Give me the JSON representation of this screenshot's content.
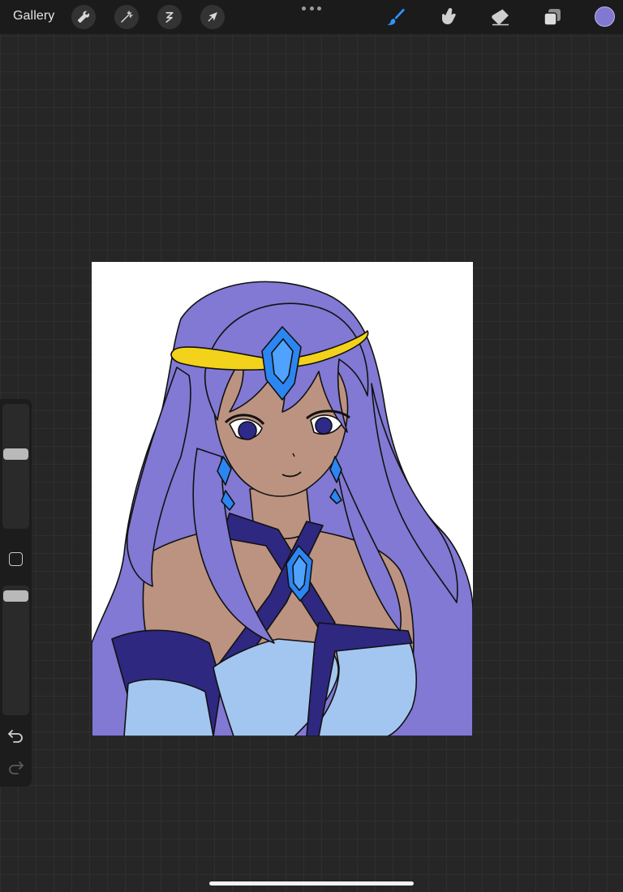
{
  "topbar": {
    "gallery_label": "Gallery",
    "left_tools": [
      {
        "name": "actions",
        "icon": "wrench-icon"
      },
      {
        "name": "adjustments",
        "icon": "magic-wand-icon"
      },
      {
        "name": "selection",
        "icon": "selection-icon"
      },
      {
        "name": "transform",
        "icon": "arrow-cursor-icon"
      }
    ],
    "right_tools": [
      {
        "name": "brush",
        "icon": "brush-icon",
        "active": true
      },
      {
        "name": "smudge",
        "icon": "smudge-finger-icon",
        "active": false
      },
      {
        "name": "eraser",
        "icon": "eraser-icon",
        "active": false
      },
      {
        "name": "layers",
        "icon": "layers-icon",
        "active": false
      }
    ],
    "current_color": "#8178d2",
    "accent_color": "#1a8fff"
  },
  "sidebar": {
    "brush_size_level": 0.65,
    "opacity_level": 0.55,
    "icons": [
      "modify-square-icon",
      "undo-icon",
      "redo-icon"
    ]
  },
  "canvas": {
    "background": "#ffffff",
    "palette": {
      "hair": "#8179d3",
      "skin": "#bc9381",
      "outfit_dark": "#2f2880",
      "outfit_light": "#a3c6f0",
      "gem": "#2c86f2",
      "circlet": "#f3d21b",
      "eyes": "#2e2a8a"
    }
  }
}
